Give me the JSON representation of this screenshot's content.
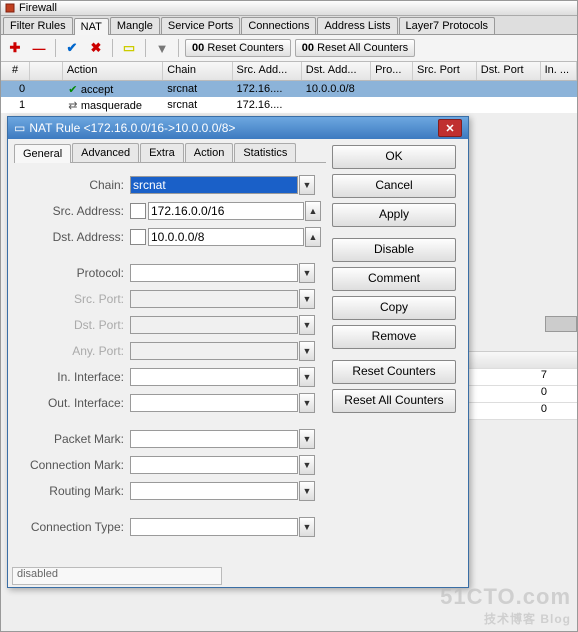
{
  "main_window": {
    "title": "Firewall"
  },
  "main_tabs": {
    "items": [
      "Filter Rules",
      "NAT",
      "Mangle",
      "Service Ports",
      "Connections",
      "Address Lists",
      "Layer7 Protocols"
    ],
    "active_index": 1
  },
  "toolbar": {
    "reset_counters": "Reset Counters",
    "reset_all_counters": "Reset All Counters",
    "oo": "00"
  },
  "grid": {
    "columns": [
      "#",
      "",
      "Action",
      "Chain",
      "Src. Add...",
      "Dst. Add...",
      "Pro...",
      "Src. Port",
      "Dst. Port",
      "In. ..."
    ],
    "rows": [
      {
        "num": "0",
        "icon": "check",
        "action": "accept",
        "chain": "srcnat",
        "src": "172.16....",
        "dst": "10.0.0.0/8",
        "selected": true
      },
      {
        "num": "1",
        "icon": "masq",
        "action": "masquerade",
        "chain": "srcnat",
        "src": "172.16....",
        "dst": "",
        "selected": false
      }
    ]
  },
  "dialog": {
    "title": "NAT Rule <172.16.0.0/16->10.0.0.0/8>",
    "tabs": [
      "General",
      "Advanced",
      "Extra",
      "Action",
      "Statistics"
    ],
    "active_tab": 0,
    "fields": {
      "chain_label": "Chain:",
      "chain_value": "srcnat",
      "src_addr_label": "Src. Address:",
      "src_addr_value": "172.16.0.0/16",
      "dst_addr_label": "Dst. Address:",
      "dst_addr_value": "10.0.0.0/8",
      "protocol_label": "Protocol:",
      "src_port_label": "Src. Port:",
      "dst_port_label": "Dst. Port:",
      "any_port_label": "Any. Port:",
      "in_if_label": "In. Interface:",
      "out_if_label": "Out. Interface:",
      "pkt_mark_label": "Packet Mark:",
      "conn_mark_label": "Connection Mark:",
      "route_mark_label": "Routing Mark:",
      "conn_type_label": "Connection Type:"
    },
    "buttons": {
      "ok": "OK",
      "cancel": "Cancel",
      "apply": "Apply",
      "disable": "Disable",
      "comment": "Comment",
      "copy": "Copy",
      "remove": "Remove",
      "reset_counters": "Reset Counters",
      "reset_all_counters": "Reset All Counters"
    },
    "status": "disabled"
  },
  "side_values": [
    "7",
    "0",
    "0"
  ],
  "watermark": {
    "big": "51CTO.com",
    "small": "技术博客  Blog"
  }
}
